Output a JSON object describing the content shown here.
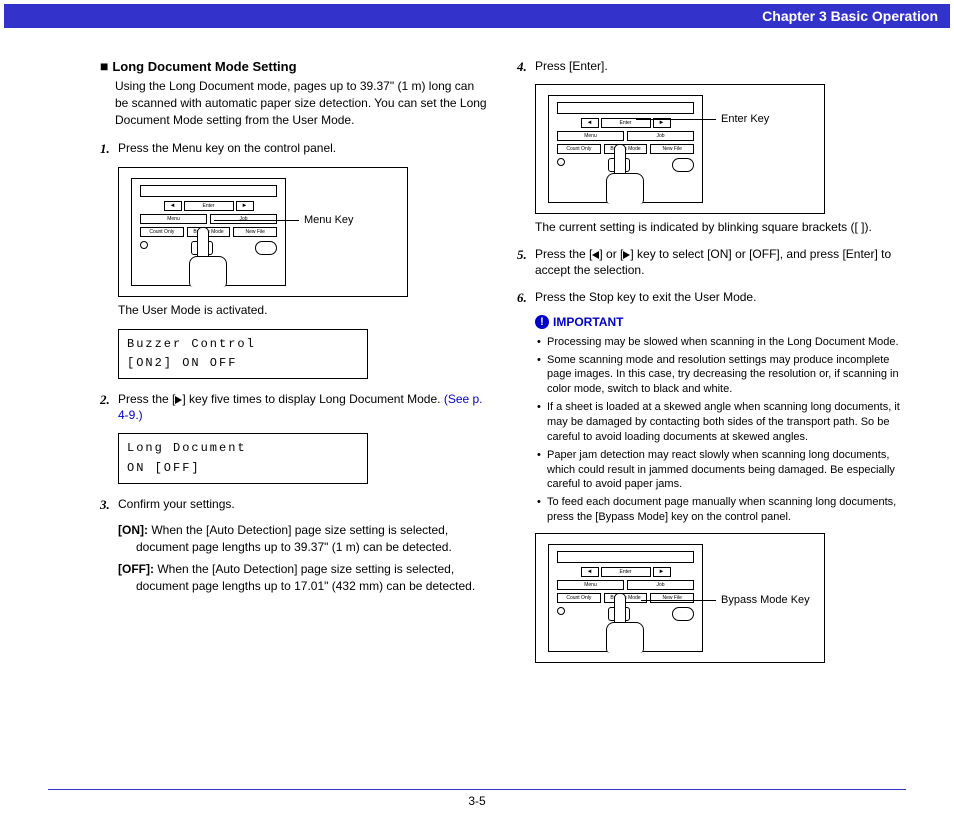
{
  "header": {
    "chapter": "Chapter 3   Basic Operation"
  },
  "left": {
    "heading": "Long Document Mode Setting",
    "intro": "Using the Long Document mode, pages up to 39.37\" (1 m) long can be scanned with automatic paper size detection. You can set the Long Document Mode setting from the User Mode.",
    "step1": {
      "num": "1.",
      "text": "Press the Menu key on the control panel."
    },
    "fig1_callout": "Menu Key",
    "panel_labels": {
      "left_arrow": "◄",
      "enter": "Enter",
      "right_arrow": "►",
      "menu": "Menu",
      "job": "Job",
      "count": "Count Only",
      "bypass": "Bypass Mode",
      "newfile": "New File"
    },
    "caption1": "The User Mode is activated.",
    "lcd1_line1": "Buzzer Control",
    "lcd1_line2": " [ON2]  ON   OFF",
    "step2": {
      "num": "2.",
      "text_a": "Press the [",
      "text_b": "] key five times to display Long Document Mode. ",
      "link": "(See p. 4-9.)"
    },
    "lcd2_line1": "Long Document",
    "lcd2_line2": "   ON   [OFF]",
    "step3": {
      "num": "3.",
      "text": "Confirm your settings."
    },
    "on_label": "[ON]:",
    "on_text": " When the [Auto Detection] page size setting is selected, document page lengths up to 39.37\" (1 m) can be detected.",
    "off_label": "[OFF]:",
    "off_text": " When the [Auto Detection] page size setting is selected, document page lengths up to 17.01\" (432 mm) can be detected."
  },
  "right": {
    "step4": {
      "num": "4.",
      "text": "Press [Enter]."
    },
    "fig2_callout": "Enter Key",
    "caption2": "The current setting is indicated by blinking square brackets ([ ]).",
    "step5": {
      "num": "5.",
      "text_a": "Press the [",
      "text_b": "] or [",
      "text_c": "] key to select [ON] or [OFF], and press [Enter] to accept the selection."
    },
    "step6": {
      "num": "6.",
      "text": "Press the Stop key to exit the User Mode."
    },
    "important_label": "IMPORTANT",
    "important_items": [
      "Processing may be slowed when scanning in the Long Document Mode.",
      "Some scanning mode and resolution settings may produce incomplete page images. In this case, try decreasing the resolution or, if scanning in color mode, switch to black and white.",
      "If a sheet is loaded at a skewed angle when scanning long documents, it may be damaged by contacting both sides of the transport path. So be careful to avoid loading documents at skewed angles.",
      "Paper jam detection may react slowly when scanning long documents, which could result in jammed documents being damaged. Be especially careful to avoid paper jams.",
      "To feed each document page manually when scanning long documents, press the [Bypass Mode] key on the control panel."
    ],
    "fig3_callout": "Bypass Mode Key"
  },
  "footer": {
    "page": "3-5"
  }
}
